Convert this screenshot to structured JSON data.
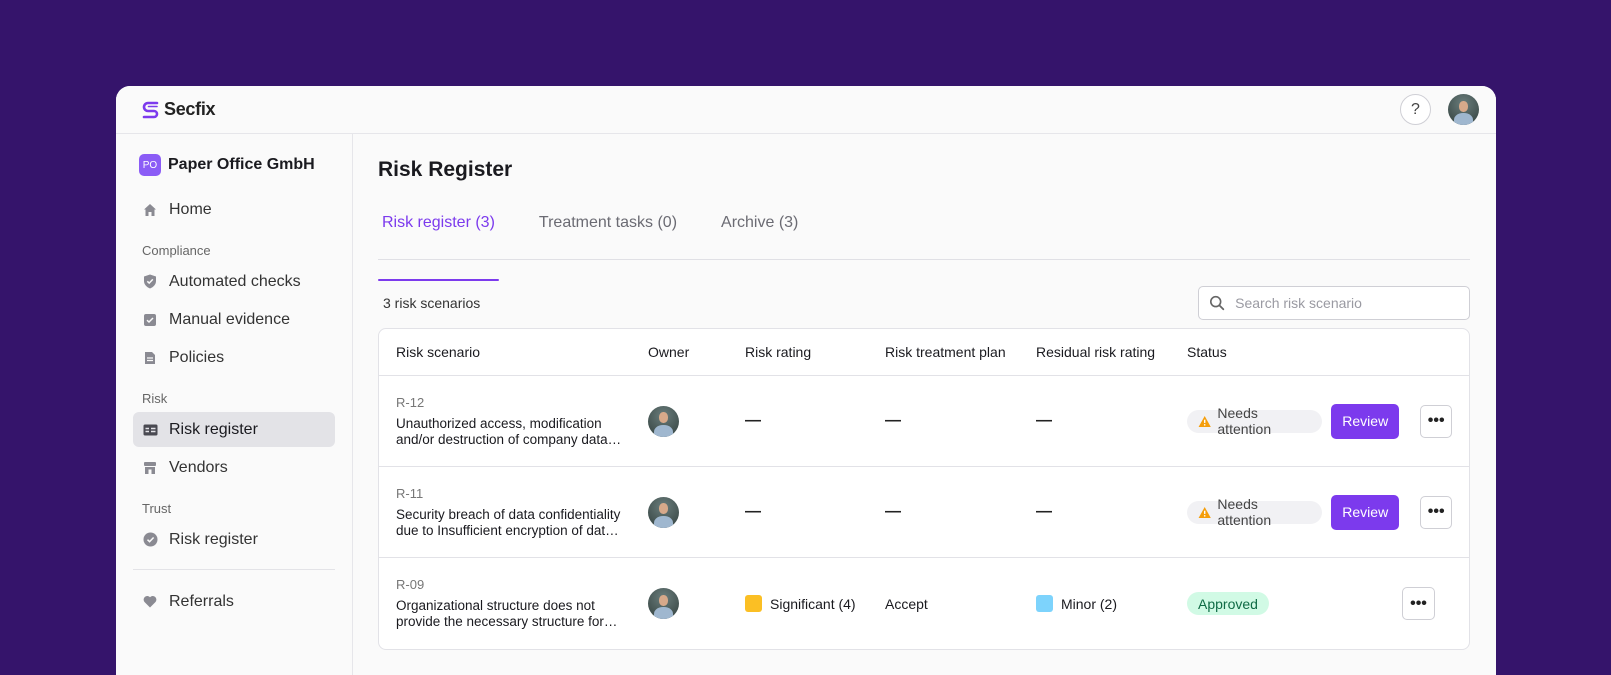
{
  "app": {
    "name": "Secfix"
  },
  "topbar": {
    "help_label": "?"
  },
  "sidebar": {
    "org_initials": "PO",
    "org_name": "Paper Office GmbH",
    "home": "Home",
    "compliance_label": "Compliance",
    "compliance_items": [
      "Automated checks",
      "Manual evidence",
      "Policies"
    ],
    "risk_label": "Risk",
    "risk_items": [
      "Risk register",
      "Vendors"
    ],
    "trust_label": "Trust",
    "trust_items": [
      "Risk register"
    ],
    "referrals": "Referrals"
  },
  "page": {
    "title": "Risk Register",
    "tabs": [
      "Risk register (3)",
      "Treatment tasks (0)",
      "Archive (3)"
    ],
    "count": "3 risk scenarios",
    "search_placeholder": "Search risk scenario"
  },
  "table": {
    "columns": [
      "Risk scenario",
      "Owner",
      "Risk rating",
      "Risk treatment plan",
      "Residual risk rating",
      "Status"
    ],
    "rows": [
      {
        "id": "R-12",
        "title": "Unauthorized access, modification and/or destruction of company data due to inadequate access controls",
        "risk_rating": "—",
        "treatment": "—",
        "residual": "—",
        "status": "Needs attention",
        "action": "Review",
        "more": "•••"
      },
      {
        "id": "R-11",
        "title": "Security breach of data confidentiality due to Insufficient encryption of data at rest and in transit",
        "risk_rating": "—",
        "treatment": "—",
        "residual": "—",
        "status": "Needs attention",
        "action": "Review",
        "more": "•••"
      },
      {
        "id": "R-09",
        "title": "Organizational structure does not provide the necessary structure for information security",
        "risk_rating": "Significant (4)",
        "treatment": "Accept",
        "residual": "Minor (2)",
        "status": "Approved",
        "more": "•••"
      }
    ]
  },
  "colors": {
    "accent": "#7c3aed",
    "background": "#35146b",
    "significant": "#fbbf24",
    "minor": "#7dd3fc",
    "warning_icon": "#f59e0b",
    "approved_bg": "#d1fae5"
  }
}
